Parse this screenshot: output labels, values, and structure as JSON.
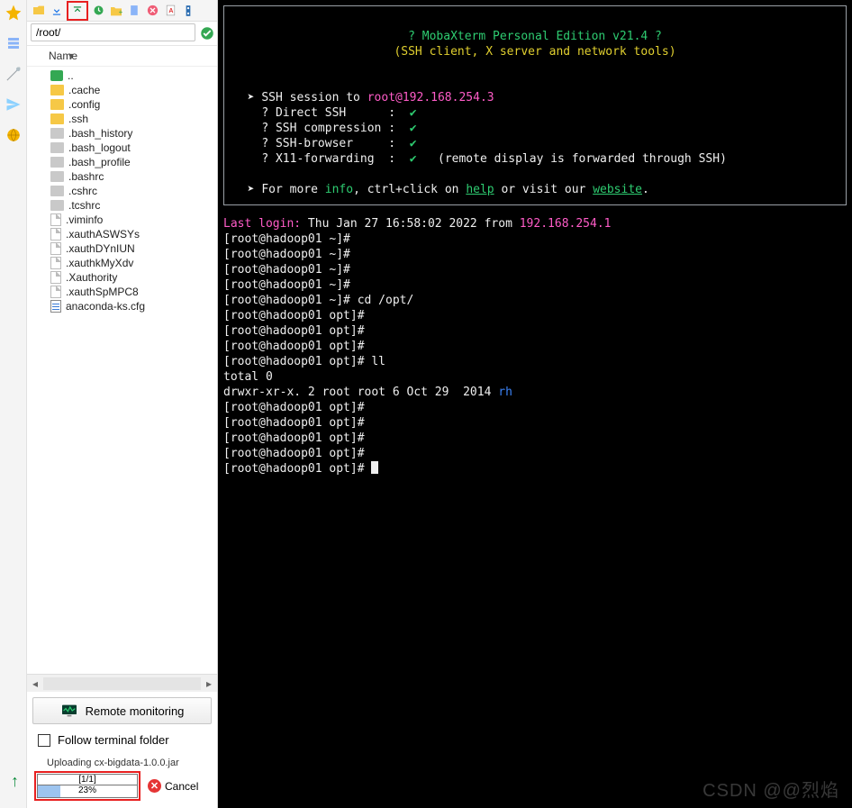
{
  "app": {
    "title": "MobaXterm Personal Edition v21.4",
    "subtitle": "(SSH client, X server and network tools)"
  },
  "sidebar": {
    "path": "/root/",
    "header": "Name",
    "items": [
      {
        "name": "..",
        "type": "up"
      },
      {
        "name": ".cache",
        "type": "folder"
      },
      {
        "name": ".config",
        "type": "folder"
      },
      {
        "name": ".ssh",
        "type": "folder"
      },
      {
        "name": ".bash_history",
        "type": "gfolder"
      },
      {
        "name": ".bash_logout",
        "type": "gfolder"
      },
      {
        "name": ".bash_profile",
        "type": "gfolder"
      },
      {
        "name": ".bashrc",
        "type": "gfolder"
      },
      {
        "name": ".cshrc",
        "type": "gfolder"
      },
      {
        "name": ".tcshrc",
        "type": "gfolder"
      },
      {
        "name": ".viminfo",
        "type": "file"
      },
      {
        "name": ".xauthASWSYs",
        "type": "file"
      },
      {
        "name": ".xauthDYnIUN",
        "type": "file"
      },
      {
        "name": ".xauthkMyXdv",
        "type": "file"
      },
      {
        "name": ".Xauthority",
        "type": "file"
      },
      {
        "name": ".xauthSpMPC8",
        "type": "file"
      },
      {
        "name": "anaconda-ks.cfg",
        "type": "cfg"
      }
    ],
    "remote_monitoring": "Remote monitoring",
    "follow": "Follow terminal folder"
  },
  "upload": {
    "label": "Uploading cx-bigdata-1.0.0.jar",
    "count": "[1/1]",
    "percent": "23%",
    "percent_num": 23,
    "cancel": "Cancel"
  },
  "terminal": {
    "ssh_to_prefix": "SSH session to ",
    "ssh_target": "root@192.168.254.3",
    "features": [
      {
        "k": "Direct SSH",
        "v": "✔"
      },
      {
        "k": "SSH compression",
        "v": "✔"
      },
      {
        "k": "SSH-browser",
        "v": "✔"
      },
      {
        "k": "X11-forwarding",
        "v": "✔",
        "extra": "(remote display is forwarded through SSH)"
      }
    ],
    "more_prefix": "For more ",
    "more_info": "info",
    "more_mid": ", ctrl+click on ",
    "more_help": "help",
    "more_mid2": " or visit our ",
    "more_site": "website",
    "lastlogin_label": "Last login:",
    "lastlogin_rest": " Thu Jan 27 16:58:02 2022 from ",
    "lastlogin_ip": "192.168.254.1",
    "lines": [
      "[root@hadoop01 ~]#",
      "[root@hadoop01 ~]#",
      "[root@hadoop01 ~]#",
      "[root@hadoop01 ~]#",
      "[root@hadoop01 ~]# cd /opt/",
      "[root@hadoop01 opt]#",
      "[root@hadoop01 opt]#",
      "[root@hadoop01 opt]#",
      "[root@hadoop01 opt]# ll",
      "total 0"
    ],
    "ls_line": {
      "perm": "drwxr-xr-x. 2 root root 6 Oct 29  2014 ",
      "name": "rh"
    },
    "tail": [
      "[root@hadoop01 opt]#",
      "[root@hadoop01 opt]#",
      "[root@hadoop01 opt]#",
      "[root@hadoop01 opt]#",
      "[root@hadoop01 opt]# "
    ]
  },
  "watermark": "CSDN @@烈焰"
}
